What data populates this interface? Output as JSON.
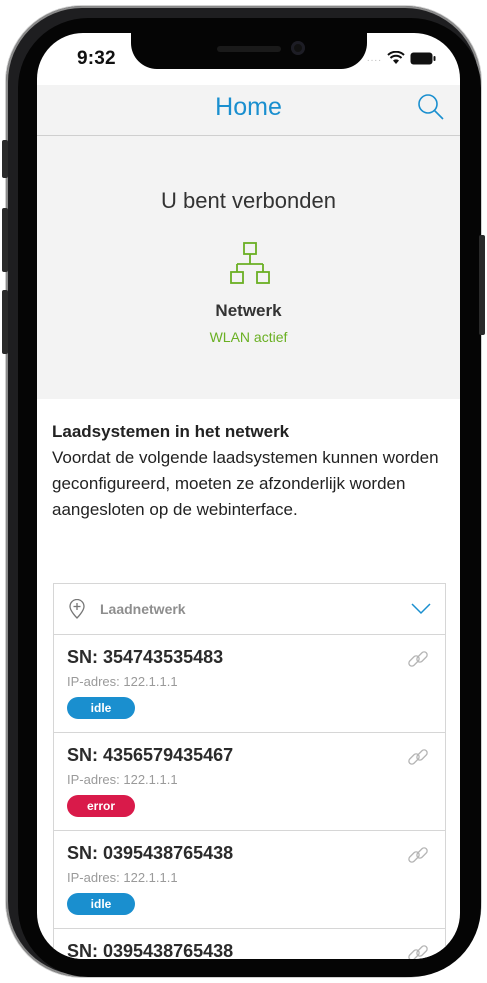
{
  "status_bar": {
    "time": "9:32"
  },
  "nav": {
    "title": "Home"
  },
  "hero": {
    "title": "U bent verbonden",
    "network_label": "Netwerk",
    "network_status": "WLAN actief"
  },
  "info": {
    "heading": "Laadsystemen in het netwerk",
    "body": "Voordat de volgende laadsystemen kunnen worden geconfigureerd, moeten ze afzonderlijk worden aangesloten op de webinterface."
  },
  "list": {
    "title": "Laadnetwerk",
    "items": [
      {
        "sn": "SN: 354743535483",
        "ip": "IP-adres: 122.1.1.1",
        "status": "idle"
      },
      {
        "sn": "SN: 4356579435467",
        "ip": "IP-adres: 122.1.1.1",
        "status": "error"
      },
      {
        "sn": "SN: 0395438765438",
        "ip": "IP-adres: 122.1.1.1",
        "status": "idle"
      },
      {
        "sn": "SN: 0395438765438",
        "ip": "",
        "status": ""
      }
    ]
  },
  "colors": {
    "accent": "#1a8fcf",
    "green": "#6ab023",
    "idle": "#1a8fcf",
    "error": "#d91a4a"
  }
}
